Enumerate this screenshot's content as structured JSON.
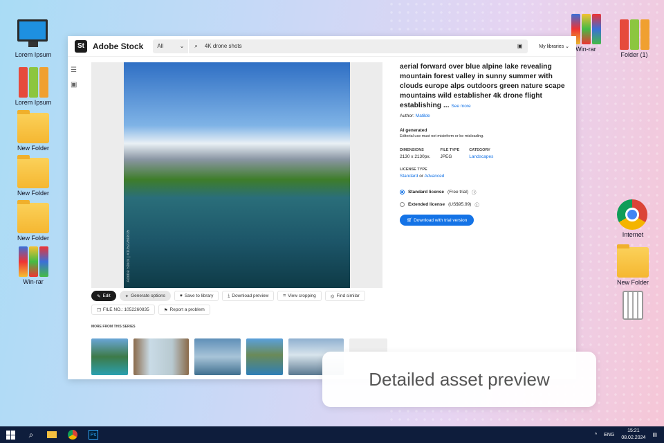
{
  "desktop": {
    "left": [
      {
        "label": "Lorem Ipsum",
        "icon": "monitor-icon"
      },
      {
        "label": "Lorem Ipsum",
        "icon": "binders-icon"
      },
      {
        "label": "New Folder",
        "icon": "folder-icon"
      },
      {
        "label": "New Folder",
        "icon": "folder-icon"
      },
      {
        "label": "New Folder",
        "icon": "folder-icon"
      },
      {
        "label": "Win-rar",
        "icon": "winrar-icon"
      }
    ],
    "right": [
      {
        "label": "Win-rar"
      },
      {
        "label": "Folder (1)"
      },
      {
        "label": "Internet"
      },
      {
        "label": "New Folder"
      },
      {
        "label": "Recycle"
      }
    ]
  },
  "header": {
    "logo": "St",
    "brand": "Adobe Stock",
    "filter": "All",
    "query": "4K drone shots",
    "libraries": "My libraries"
  },
  "asset": {
    "watermark": "Adobe Stock | #1052260835",
    "title": "aerial forward over blue alpine lake revealing mountain forest valley in sunny summer with clouds europe alps outdoors green nature scape mountains wild establisher 4k drone flight establishing ...",
    "see_more": "See more",
    "author_label": "Author:",
    "author": "Matilde",
    "ai_title": "AI generated",
    "ai_note": "Editorial use must not misinform or be misleading.",
    "dim_label": "DIMENSIONS",
    "dim": "2130 x 2130px.",
    "type_label": "FILE TYPE",
    "type": "JPEG",
    "cat_label": "CATEGORY",
    "cat": "Landscapes",
    "license_label": "LICENSE TYPE",
    "lic_standard": "Standard",
    "lic_or": "or",
    "lic_advanced": "Advanced",
    "opt1": "Standard license",
    "opt1_note": "(Free trial)",
    "opt2": "Extended license",
    "opt2_note": "(US$95.99)",
    "download": "Download with trial version"
  },
  "buttons": {
    "edit": "Edit",
    "generate": "Generate options",
    "save": "Save to library",
    "download_preview": "Download preview",
    "crop": "View cropping",
    "similar": "Find similar",
    "file_no": "FILE NO.: 1052260835",
    "report": "Report a problem"
  },
  "series_label": "MORE FROM THIS SERIES",
  "caption": "Detailed asset preview",
  "taskbar": {
    "lang": "ENG",
    "time": "15:21",
    "date": "08.02.2024"
  }
}
